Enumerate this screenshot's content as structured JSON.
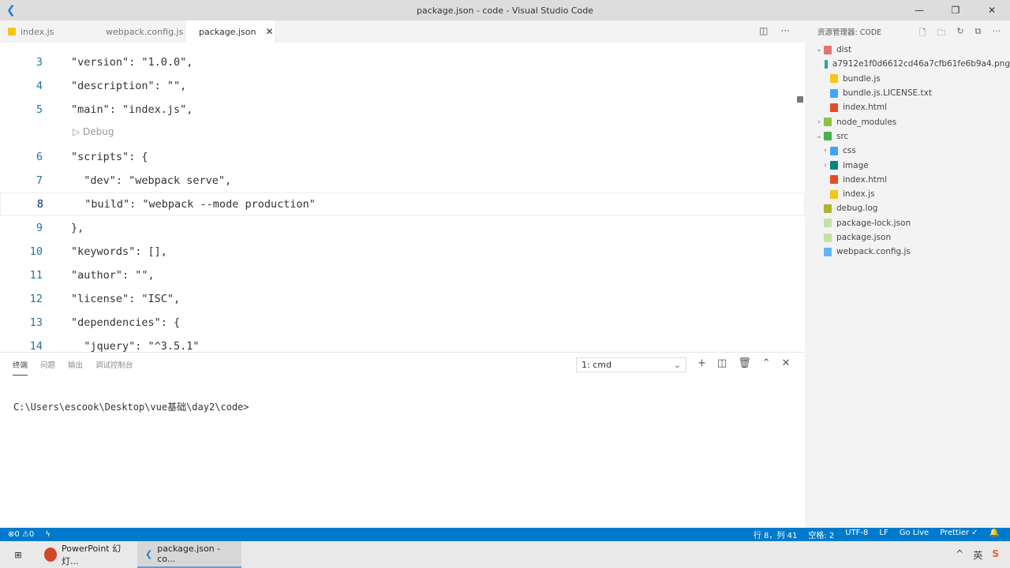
{
  "window": {
    "title": "package.json - code - Visual Studio Code"
  },
  "tabs": [
    {
      "label": "index.js",
      "icon": "js-icon",
      "color": "#f5c518"
    },
    {
      "label": "webpack.config.js",
      "icon": "webpack-icon",
      "color": "#3b8fd6"
    },
    {
      "label": "package.json",
      "icon": "nodejs-icon",
      "color": "#8bc34a",
      "active": true
    }
  ],
  "editor": {
    "current_line": "8",
    "lines": [
      {
        "n": "3",
        "text": "\"version\": \"1.0.0\","
      },
      {
        "n": "4",
        "text": "\"description\": \"\","
      },
      {
        "n": "5",
        "text": "\"main\": \"index.js\","
      },
      {
        "n": "6",
        "text": "\"scripts\": {"
      },
      {
        "n": "7",
        "text": "  \"dev\": \"webpack serve\","
      },
      {
        "n": "8",
        "text": "  \"build\": \"webpack --mode production\""
      },
      {
        "n": "9",
        "text": "},"
      },
      {
        "n": "10",
        "text": "\"keywords\": [],"
      },
      {
        "n": "11",
        "text": "\"author\": \"\","
      },
      {
        "n": "12",
        "text": "\"license\": \"ISC\","
      },
      {
        "n": "13",
        "text": "\"dependencies\": {"
      },
      {
        "n": "14",
        "text": "  \"jquery\": \"^3.5.1\""
      }
    ],
    "codelens": "▷ Debug"
  },
  "explorer": {
    "title": "资源管理器: CODE",
    "items": [
      {
        "label": "dist",
        "depth": 0,
        "twisty": "v",
        "color": "#e57373"
      },
      {
        "label": "a7912e1f0d6612cd46a7cfb61fe6b9a4.png",
        "depth": 1,
        "twisty": "",
        "color": "#26a69a"
      },
      {
        "label": "bundle.js",
        "depth": 1,
        "twisty": "",
        "color": "#f5c518"
      },
      {
        "label": "bundle.js.LICENSE.txt",
        "depth": 1,
        "twisty": "",
        "color": "#42a5f5"
      },
      {
        "label": "index.html",
        "depth": 1,
        "twisty": "",
        "color": "#e44d26"
      },
      {
        "label": "node_modules",
        "depth": 0,
        "twisty": ">",
        "color": "#8bc34a"
      },
      {
        "label": "src",
        "depth": 0,
        "twisty": "v",
        "color": "#4caf50"
      },
      {
        "label": "css",
        "depth": 1,
        "twisty": ">",
        "color": "#42a5f5"
      },
      {
        "label": "image",
        "depth": 1,
        "twisty": ">",
        "color": "#00897b"
      },
      {
        "label": "index.html",
        "depth": 1,
        "twisty": "",
        "color": "#e44d26"
      },
      {
        "label": "index.js",
        "depth": 1,
        "twisty": "",
        "color": "#f5c518"
      },
      {
        "label": "debug.log",
        "depth": 0,
        "twisty": "",
        "color": "#afb42b"
      },
      {
        "label": "package-lock.json",
        "depth": 0,
        "twisty": "",
        "color": "#c5e1a5"
      },
      {
        "label": "package.json",
        "depth": 0,
        "twisty": "",
        "color": "#c5e1a5"
      },
      {
        "label": "webpack.config.js",
        "depth": 0,
        "twisty": "",
        "color": "#64b5f6"
      }
    ]
  },
  "panel": {
    "tabs": [
      "终端",
      "问题",
      "输出",
      "调试控制台"
    ],
    "terminal_select": "1: cmd",
    "prompt": "C:\\Users\\escook\\Desktop\\vue基础\\day2\\code>"
  },
  "statusbar": {
    "errors": "⊗0 ⚠0",
    "position": "行 8，列 41",
    "spaces": "空格: 2",
    "encoding": "UTF-8",
    "eol": "LF",
    "golive": "Go Live",
    "prettier": "Prettier ✓"
  },
  "taskbar": {
    "items": [
      {
        "label": "PowerPoint 幻灯...",
        "color": "#d24726"
      },
      {
        "label": "package.json - co...",
        "color": "#1a7fd4",
        "active": true
      }
    ],
    "ime": "英"
  }
}
